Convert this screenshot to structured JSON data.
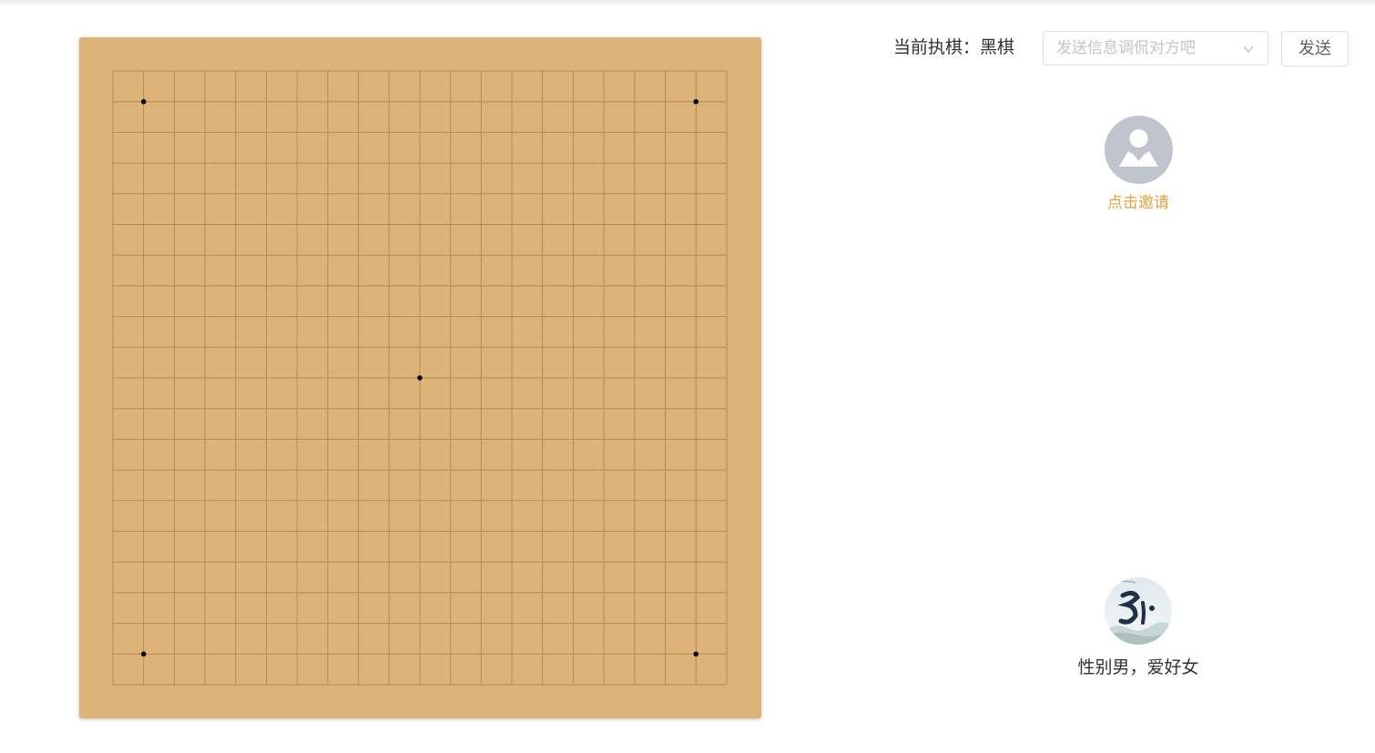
{
  "board": {
    "size": 21,
    "star_points": [
      [
        1,
        1
      ],
      [
        19,
        1
      ],
      [
        10,
        10
      ],
      [
        1,
        19
      ],
      [
        19,
        19
      ]
    ],
    "background_color": "#dcb379",
    "line_color": "#b8894f",
    "star_color": "#000000"
  },
  "status": {
    "text": "当前执棋：黑棋"
  },
  "message": {
    "placeholder": "发送信息调侃对方吧",
    "send_label": "发送"
  },
  "opponent": {
    "avatar_icon": "user-silhouette-icon",
    "invite_text": "点击邀请",
    "invite_color": "#e6a23c"
  },
  "self": {
    "avatar_icon": "calligraphy-avatar",
    "name": "性别男，爱好女"
  }
}
